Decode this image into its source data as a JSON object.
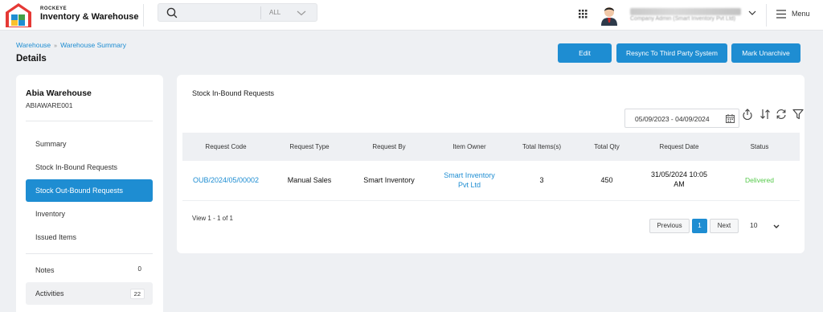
{
  "brand": {
    "small": "ROCKEYE",
    "name": "Inventory & Warehouse"
  },
  "search": {
    "placeholder": "",
    "scope": "ALL"
  },
  "user": {
    "role": "Company Admin (Smart Inventory Pvt Ltd)"
  },
  "menu": {
    "label": "Menu"
  },
  "breadcrumb": {
    "items": [
      "Warehouse",
      "Warehouse Summary"
    ]
  },
  "page": {
    "title": "Details"
  },
  "actions": {
    "edit": "Edit",
    "resync": "Resync To Third Party System",
    "unarchive": "Mark Unarchive"
  },
  "warehouse": {
    "name": "Abia Warehouse",
    "code": "ABIAWARE001"
  },
  "sidebar": {
    "items": [
      {
        "label": "Summary"
      },
      {
        "label": "Stock In-Bound Requests"
      },
      {
        "label": "Stock Out-Bound Requests",
        "active": true
      },
      {
        "label": "Inventory"
      },
      {
        "label": "Issued Items"
      }
    ],
    "notes": {
      "label": "Notes",
      "count": "0"
    },
    "activities": {
      "label": "Activities",
      "count": "22"
    }
  },
  "panel": {
    "title": "Stock In-Bound Requests",
    "date_range": "05/09/2023 - 04/09/2024",
    "columns": [
      "Request Code",
      "Request Type",
      "Request By",
      "Item Owner",
      "Total Items(s)",
      "Total Qty",
      "Request Date",
      "Status"
    ],
    "rows": [
      {
        "request_code": "OUB/2024/05/00002",
        "request_type": "Manual Sales",
        "request_by": "Smart Inventory",
        "item_owner_1": "Smart Inventory",
        "item_owner_2": "Pvt Ltd",
        "total_items": "3",
        "total_qty": "450",
        "request_date_1": "31/05/2024 10:05",
        "request_date_2": "AM",
        "status": "Delivered"
      }
    ],
    "view_info": "View 1 - 1 of 1",
    "pagination": {
      "previous": "Previous",
      "current": "1",
      "next": "Next",
      "page_size": "10"
    }
  },
  "colors": {
    "accent": "#1e8dd2",
    "delivered": "#55c94a",
    "background": "#eef0f3"
  }
}
